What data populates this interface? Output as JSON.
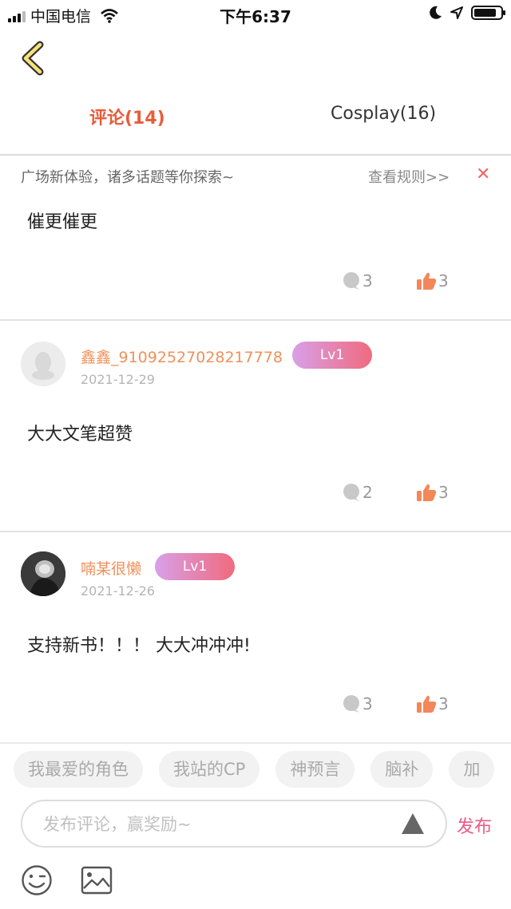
{
  "status_bar": {
    "carrier": "中国电信",
    "time": "下午6:37",
    "battery_level": 0.85
  },
  "tabs": [
    {
      "label": "评论(14)",
      "active": true
    },
    {
      "label": "Cosplay(16)",
      "active": false
    }
  ],
  "notice": {
    "text": "广场新体验，诸多话题等你探索~",
    "link": "查看规则>>",
    "close": "✕"
  },
  "comments": [
    {
      "user": "",
      "level": "",
      "date": "",
      "text": "催更催更",
      "replies": "3",
      "likes": "3"
    },
    {
      "user": "鑫鑫_91092527028217778",
      "level": "Lv1",
      "date": "2021-12-29",
      "text": "大大文笔超赞",
      "replies": "2",
      "likes": "3"
    },
    {
      "user": "喃某很懒",
      "level": "Lv1",
      "date": "2021-12-26",
      "text": "支持新书！！！ 大大冲冲冲!",
      "replies": "3",
      "likes": "3"
    }
  ],
  "topics": [
    "我最爱的角色",
    "我站的CP",
    "神预言",
    "脑补",
    "加"
  ],
  "composer": {
    "placeholder": "发布评论，赢奖励~",
    "publish_label": "发布"
  },
  "colors": {
    "accent": "#e85c3a",
    "username": "#f0915a",
    "like": "#f3875a",
    "publish": "#ea5a86"
  },
  "icons": {
    "back": "back-icon",
    "comment": "comment-bubble-icon",
    "like": "thumbs-up-icon",
    "send": "send-triangle-icon",
    "emoji": "emoji-icon",
    "image": "image-icon"
  }
}
